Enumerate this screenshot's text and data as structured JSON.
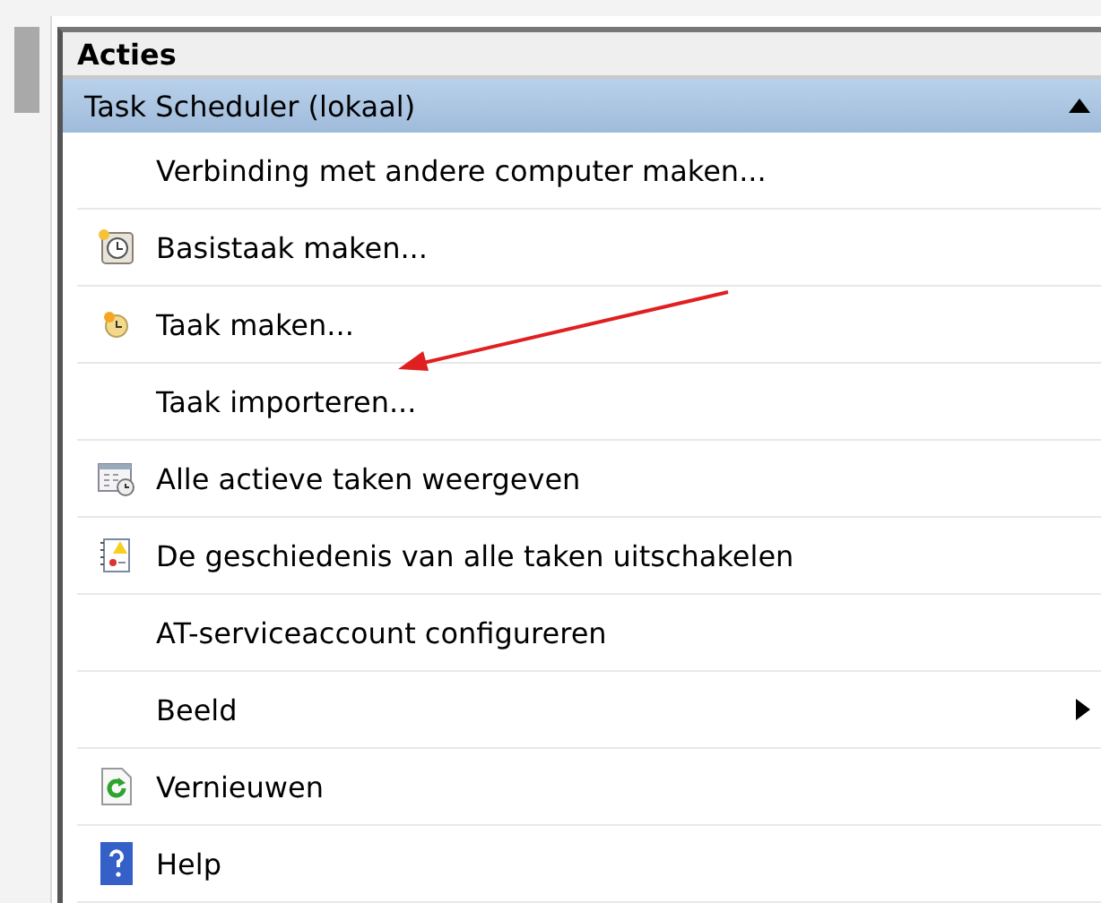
{
  "panel": {
    "title": "Acties"
  },
  "section": {
    "title": "Task Scheduler (lokaal)",
    "expanded": true
  },
  "items": [
    {
      "label": "Verbinding met andere computer maken...",
      "submenu": false
    },
    {
      "label": "Basistaak maken...",
      "submenu": false
    },
    {
      "label": "Taak maken...",
      "submenu": false
    },
    {
      "label": "Taak importeren...",
      "submenu": false
    },
    {
      "label": "Alle actieve taken weergeven",
      "submenu": false
    },
    {
      "label": "De geschiedenis van alle taken uitschakelen",
      "submenu": false
    },
    {
      "label": "AT-serviceaccount configureren",
      "submenu": false
    },
    {
      "label": "Beeld",
      "submenu": true
    },
    {
      "label": "Vernieuwen",
      "submenu": false
    },
    {
      "label": "Help",
      "submenu": false
    }
  ]
}
